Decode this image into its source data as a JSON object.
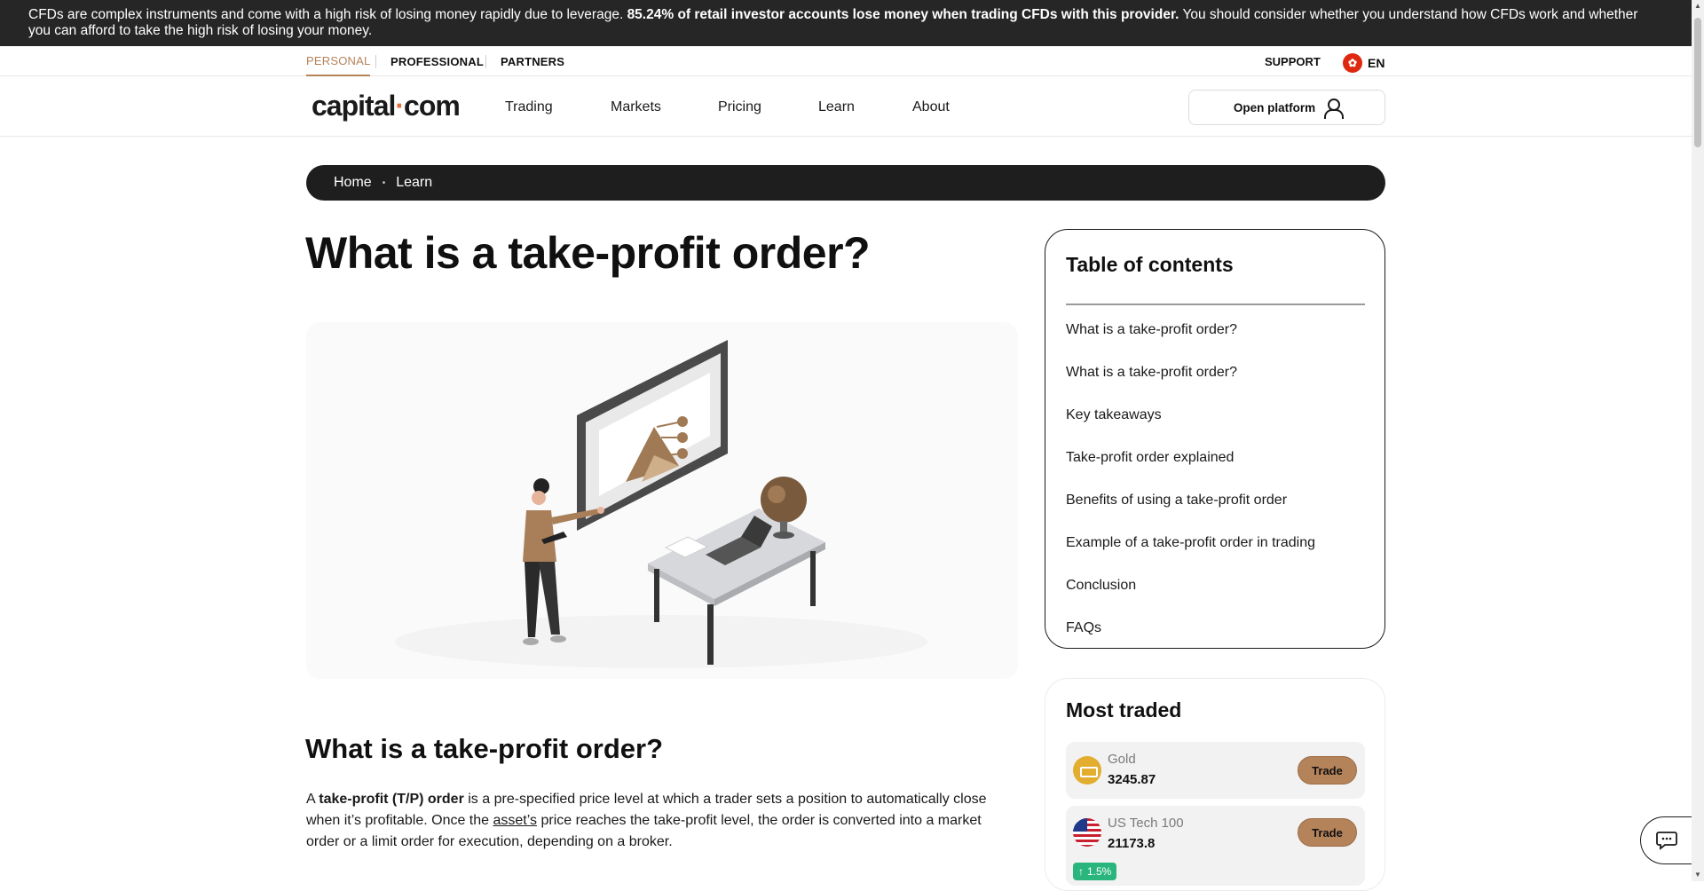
{
  "risk_warning": {
    "text_before": "CFDs are complex instruments and come with a high risk of losing money rapidly due to leverage. ",
    "text_bold": "85.24% of retail investor accounts lose money when trading CFDs with this provider.",
    "text_after": " You should consider whether you understand how CFDs work and whether you can afford to take the high risk of losing your money."
  },
  "topbar": {
    "segments": [
      "PERSONAL",
      "PROFESSIONAL",
      "PARTNERS"
    ],
    "support": "SUPPORT",
    "language": "EN"
  },
  "nav": {
    "logo_left": "capital",
    "logo_dot": "·",
    "logo_right": "com",
    "items": [
      "Trading",
      "Markets",
      "Pricing",
      "Learn",
      "About"
    ],
    "open_platform": "Open platform"
  },
  "breadcrumb": {
    "items": [
      "Home",
      "Learn"
    ],
    "separator": "•"
  },
  "article": {
    "title": "What is a take-profit order?",
    "section_heading": "What is a take-profit order?",
    "para_prefix": "A ",
    "para_bold": "take-profit (T/P) order",
    "para_mid": " is a pre-specified price level at which a trader sets a position to automatically close when it’s profitable. Once the ",
    "para_link": "asset’s",
    "para_suffix": " price reaches the take-profit level, the order is converted into a market order or a limit order for execution, depending on a broker."
  },
  "toc": {
    "title": "Table of contents",
    "items": [
      "What is a take-profit order?",
      "What is a take-profit order?",
      "Key takeaways",
      "Take-profit order explained",
      "Benefits of using a take-profit order",
      "Example of a take-profit order in trading",
      "Conclusion",
      "FAQs"
    ]
  },
  "most_traded": {
    "title": "Most traded",
    "instruments": [
      {
        "name": "Gold",
        "price": "3245.87",
        "action": "Trade"
      },
      {
        "name": "US Tech 100",
        "price": "21173.8",
        "action": "Trade",
        "change": "1.5%",
        "change_arrow": "↑"
      }
    ]
  },
  "colors": {
    "accent": "#b5835a",
    "risk_bg": "#262626",
    "breadcrumb_bg": "#1e1e1e",
    "positive": "#2ab57d"
  },
  "icons": [
    "flag-hk-icon",
    "user-icon",
    "gold-icon",
    "us-flag-icon",
    "chat-icon",
    "arrow-up-icon"
  ]
}
